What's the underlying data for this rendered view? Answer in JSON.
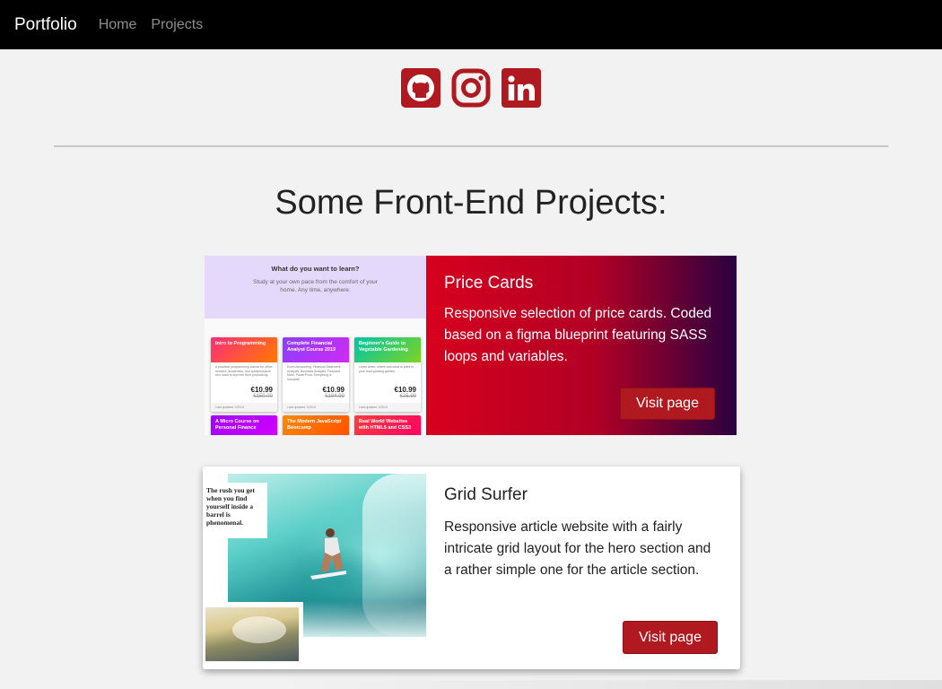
{
  "nav": {
    "brand": "Portfolio",
    "links": [
      "Home",
      "Projects"
    ]
  },
  "socials": [
    {
      "icon": "github-icon"
    },
    {
      "icon": "instagram-icon"
    },
    {
      "icon": "linkedin-icon"
    }
  ],
  "colors": {
    "accent": "#b0191f",
    "navbar": "#000000",
    "background": "#f2f2f2"
  },
  "main": {
    "title": "Some Front-End Projects:",
    "projects": [
      {
        "title": "Price Cards",
        "description": "Responsive selection of price cards. Coded based on a figma blueprint featuring SASS loops and variables.",
        "button": "Visit page",
        "thumbnail": {
          "heading": "What do you want to learn?",
          "subheading": "Study at your own pace from the comfort of your home. Any time, anywhere.",
          "cards": [
            {
              "title": "Intro to Programming",
              "price": "€10.99",
              "old_price": "€150.00"
            },
            {
              "title": "Complete Financial Analyst Course 2019",
              "price": "€10.99",
              "old_price": "€194.99"
            },
            {
              "title": "Beginner's Guide to Vegetable Gardening",
              "price": "€10.99",
              "old_price": "€25.99"
            },
            {
              "title": "A Micro Course on Personal Finance",
              "price": "",
              "old_price": ""
            },
            {
              "title": "The Modern JavaScript Bootcamp",
              "price": "",
              "old_price": ""
            },
            {
              "title": "Real World Websites with HTML5 and CSS3",
              "price": "",
              "old_price": ""
            }
          ]
        }
      },
      {
        "title": "Grid Surfer",
        "description": "Responsive article website with a fairly intricate grid layout for the hero section and a rather simple one for the article section.",
        "button": "Visit page",
        "thumbnail": {
          "quote": "The rush you get when you find yourself inside a barrel is phenomenal."
        }
      }
    ]
  }
}
